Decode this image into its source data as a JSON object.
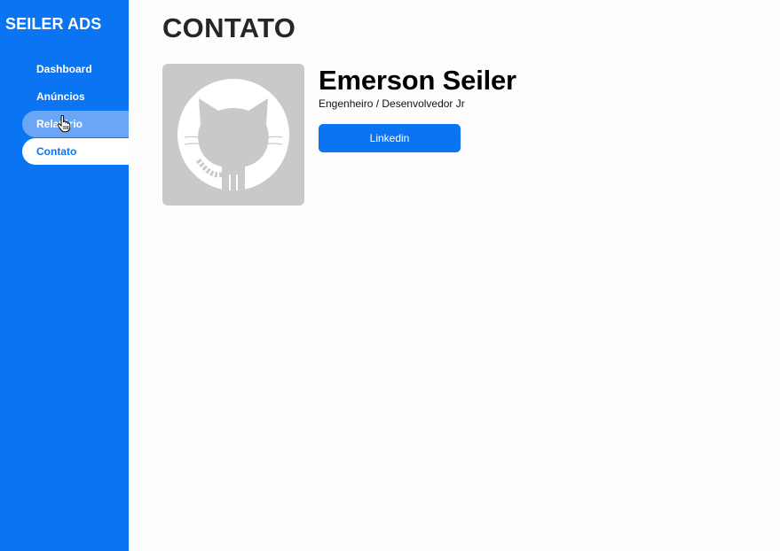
{
  "sidebar": {
    "brand": "SEILER ADS",
    "items": [
      {
        "label": "Dashboard",
        "state": "default"
      },
      {
        "label": "Anúncios",
        "state": "default"
      },
      {
        "label": "Relatório",
        "state": "hover"
      },
      {
        "label": "Contato",
        "state": "active"
      }
    ]
  },
  "main": {
    "title": "CONTATO",
    "profile": {
      "avatar_icon": "github-octocat-icon",
      "name": "Emerson Seiler",
      "role": "Engenheiro / Desenvolvedor Jr",
      "linkedin_label": "Linkedin"
    }
  },
  "colors": {
    "sidebar_bg": "#0b74f3",
    "nav_hover_bg": "#6aa6f6",
    "nav_active_bg": "#ffffff",
    "button_bg": "#0b74f3",
    "avatar_bg": "#c9c9c9"
  }
}
